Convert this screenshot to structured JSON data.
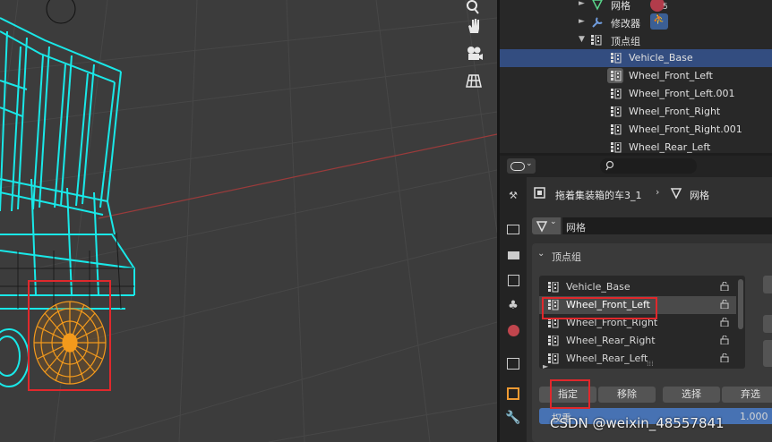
{
  "outliner": {
    "items": [
      {
        "label": "网格",
        "badge": "5"
      },
      {
        "label": "修改器"
      },
      {
        "label": "顶点组"
      },
      {
        "label": "Vehicle_Base"
      },
      {
        "label": "Wheel_Front_Left"
      },
      {
        "label": "Wheel_Front_Left.001"
      },
      {
        "label": "Wheel_Front_Right"
      },
      {
        "label": "Wheel_Front_Right.001"
      },
      {
        "label": "Wheel_Rear_Left"
      }
    ]
  },
  "properties": {
    "breadcrumb_object": "拖着集装箱的车3_1",
    "breadcrumb_data": "网格",
    "mesh_name": "网格",
    "vertex_groups_title": "顶点组",
    "vertex_groups": [
      "Vehicle_Base",
      "Wheel_Front_Left",
      "Wheel_Front_Right",
      "Wheel_Rear_Right",
      "Wheel_Rear_Left"
    ],
    "selected_group": "Wheel_Front_Left",
    "buttons": {
      "assign": "指定",
      "remove": "移除",
      "select": "选择",
      "deselect": "弃选"
    },
    "weight_label": "权重",
    "weight_value": "1.000"
  },
  "watermark": "CSDN @weixin_48557841",
  "colors": {
    "wire": "#19e8e8",
    "selected_wheel": "#f39a1c",
    "highlight": "#e0282c",
    "selection": "#334d80",
    "weight_bar": "#4772b3"
  },
  "icons": [
    "zoom-icon",
    "hand-pan-icon",
    "camera-icon",
    "grid-icon",
    "mesh-icon",
    "modifier-icon",
    "vertex-group-icon",
    "lock-icon",
    "search-icon"
  ]
}
